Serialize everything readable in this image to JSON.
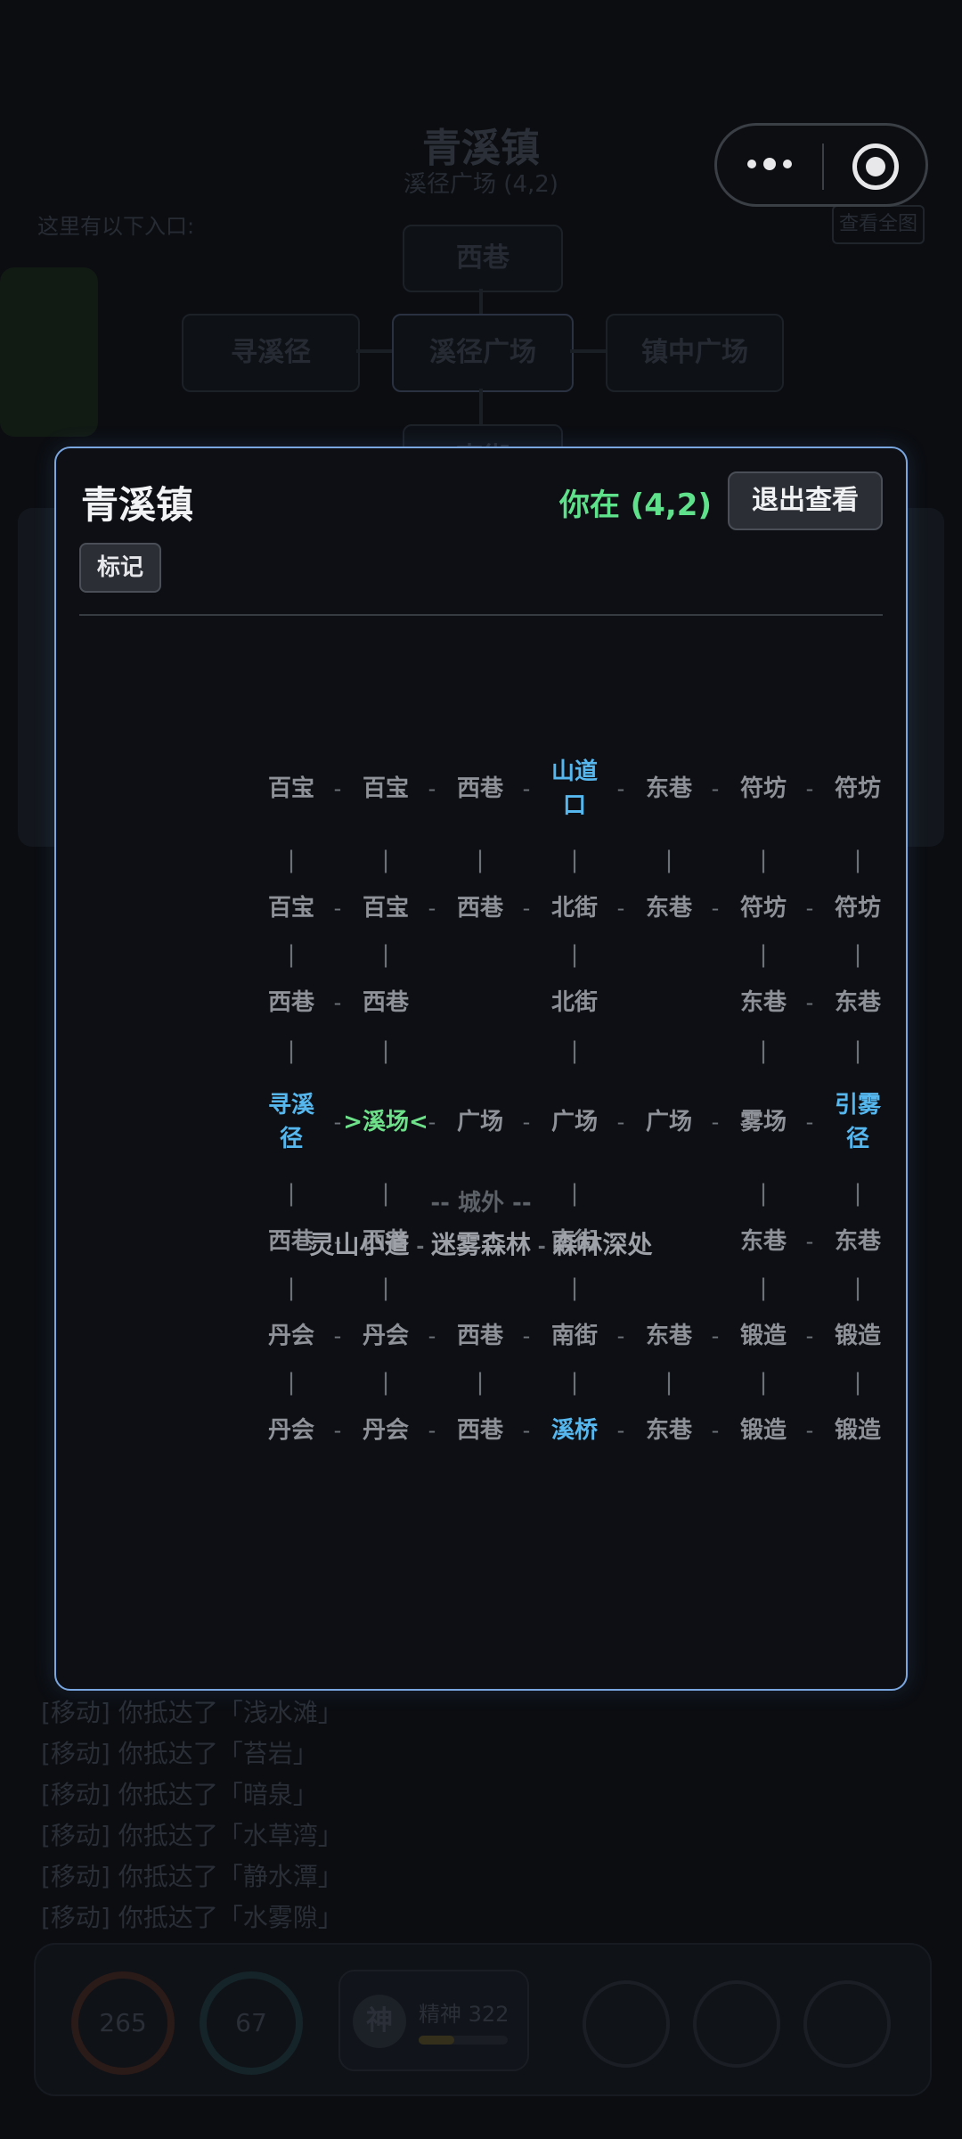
{
  "background": {
    "title": "青溪镇",
    "subtitle": "溪径广场 (4,2)",
    "hint": "这里有以下入口:",
    "view_all": "查看全图",
    "nodes": {
      "north": "西巷",
      "west": "寻溪径",
      "center": "溪径广场",
      "east": "镇中广场",
      "south": "南街"
    },
    "logs": [
      "[移动] 你抵达了「浅水滩」",
      "[移动] 你抵达了「苔岩」",
      "[移动] 你抵达了「暗泉」",
      "[移动] 你抵达了「水草湾」",
      "[移动] 你抵达了「静水潭」",
      "[移动] 你抵达了「水雾隙」"
    ],
    "stats": {
      "hp": "265",
      "mp": "67",
      "spirit_icon": "神",
      "spirit_label": "精神",
      "spirit_value": "322",
      "spirit_fill": 0.4
    }
  },
  "capsule": {
    "more_icon": "more-dots-icon",
    "close_icon": "target-close-icon"
  },
  "modal": {
    "title": "青溪镇",
    "position": "你在 (4,2)",
    "exit_label": "退出查看",
    "mark_label": "标记",
    "outside_label": "-- 城外 --",
    "route": [
      "灵山小道",
      "迷雾森林",
      "森林深处"
    ],
    "colors": {
      "current": "#6ee08a",
      "exit_node": "#56b7ee",
      "normal": "#8e9298",
      "border": "#7aa6e0"
    },
    "grid": {
      "rows": [
        [
          "百宝",
          "百宝",
          "西巷",
          "山道口",
          "东巷",
          "符坊",
          "符坊"
        ],
        [
          "百宝",
          "百宝",
          "西巷",
          "北街",
          "东巷",
          "符坊",
          "符坊"
        ],
        [
          "西巷",
          "西巷",
          "",
          "北街",
          "",
          "东巷",
          "东巷"
        ],
        [
          "寻溪径",
          ">溪场<",
          "广场",
          "广场",
          "广场",
          "雾场",
          "引雾径"
        ],
        [
          "西巷",
          "西巷",
          "",
          "南街",
          "",
          "东巷",
          "东巷"
        ],
        [
          "丹会",
          "丹会",
          "西巷",
          "南街",
          "东巷",
          "锻造",
          "锻造"
        ],
        [
          "丹会",
          "丹会",
          "西巷",
          "溪桥",
          "东巷",
          "锻造",
          "锻造"
        ]
      ],
      "h_sep": "-",
      "v_sep": "|"
    }
  }
}
